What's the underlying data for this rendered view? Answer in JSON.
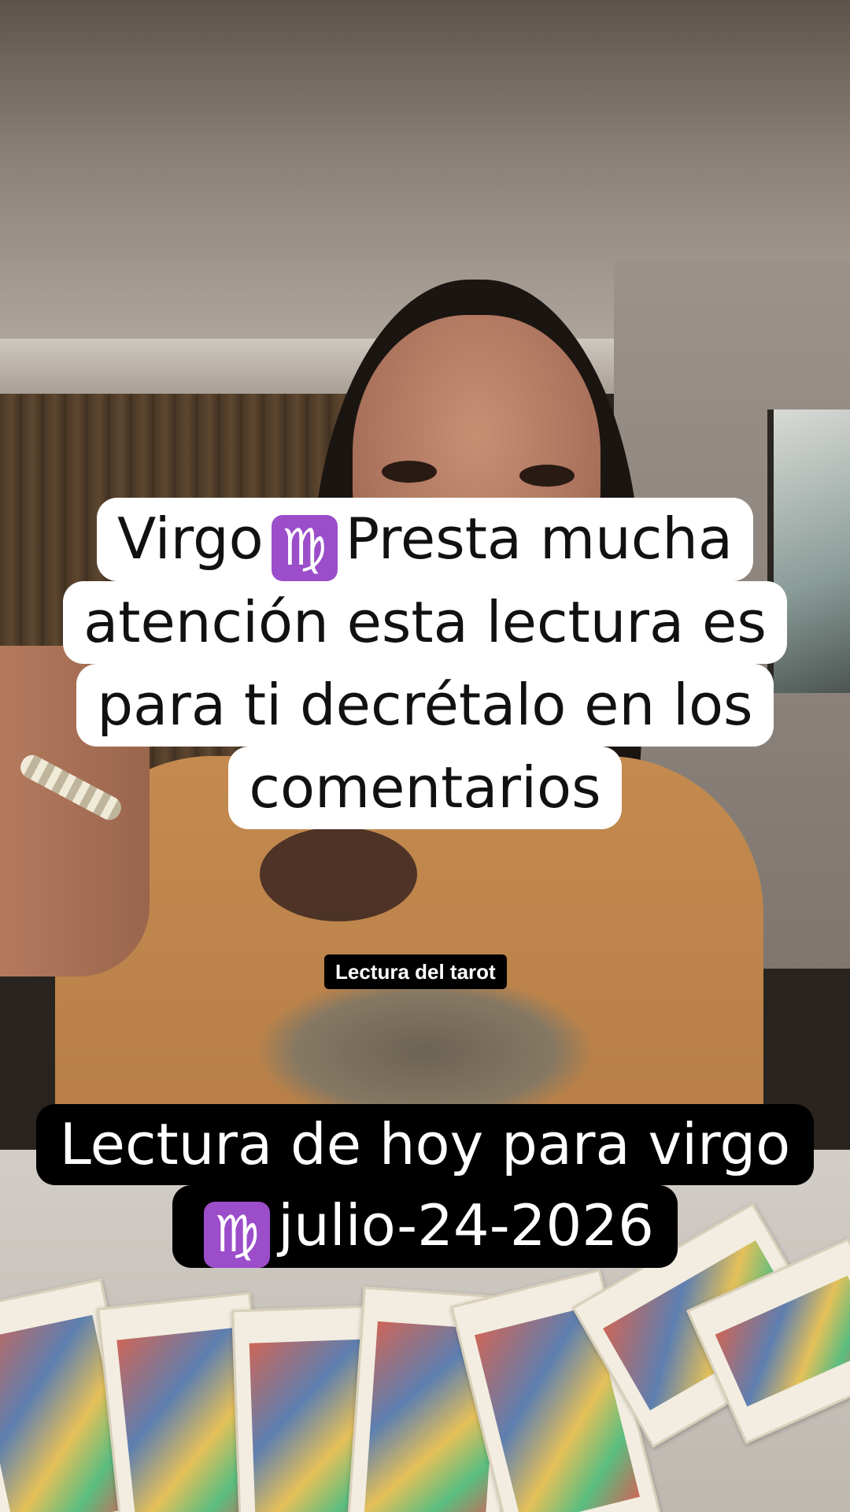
{
  "caption_top": {
    "word1": "Virgo",
    "icon": "virgo-zodiac-icon",
    "line1_rest": "Presta mucha",
    "line2": "atención esta lectura es",
    "line3": "para ti decrétalo en los",
    "line4": "comentarios"
  },
  "label": {
    "text": "Lectura del tarot"
  },
  "caption_bottom": {
    "line1": "Lectura de hoy para virgo",
    "icon": "virgo-zodiac-icon",
    "line2_rest": "julio-24-2026"
  },
  "zodiac_symbol": "♍",
  "colors": {
    "zodiac_bg": "#9b4dca",
    "caption_top_bg": "#ffffff",
    "caption_bottom_bg": "#000000"
  }
}
